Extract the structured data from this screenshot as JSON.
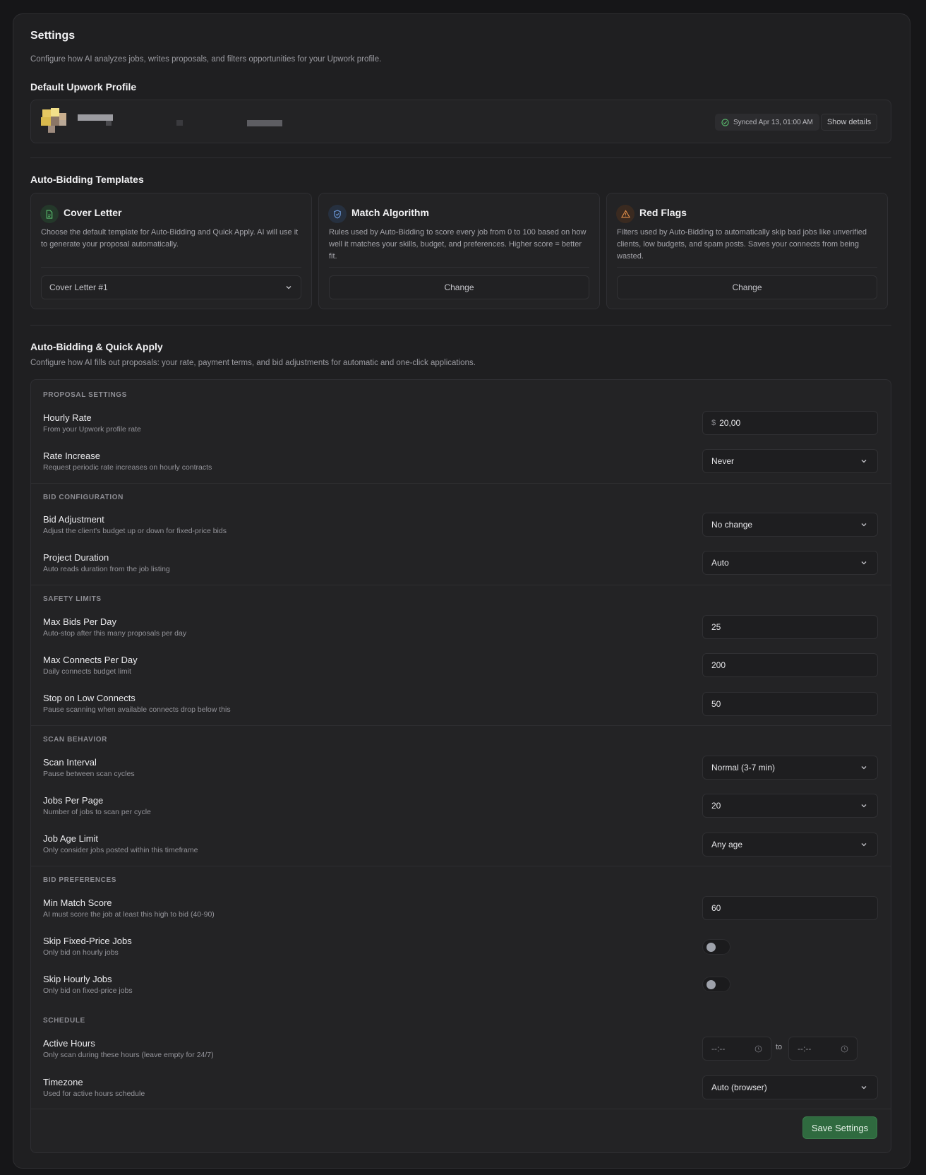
{
  "header": {
    "title": "Settings",
    "subtitle": "Configure how AI analyzes jobs, writes proposals, and filters opportunities for your Upwork profile."
  },
  "profile": {
    "section_title": "Default Upwork Profile",
    "sync_status": "Synced Apr 13, 01:00 AM",
    "show_details_label": "Show details"
  },
  "templates": {
    "section_title": "Auto-Bidding Templates",
    "cards": [
      {
        "title": "Cover Letter",
        "icon": "document-icon",
        "description": "Choose the default template for Auto-Bidding and Quick Apply. AI will use it to generate your proposal automatically.",
        "control_value": "Cover Letter #1"
      },
      {
        "title": "Match Algorithm",
        "icon": "shield-icon",
        "description": "Rules used by Auto-Bidding to score every job from 0 to 100 based on how well it matches your skills, budget, and preferences. Higher score = better fit.",
        "control_value": "Change"
      },
      {
        "title": "Red Flags",
        "icon": "warning-icon",
        "description": "Filters used by Auto-Bidding to automatically skip bad jobs like unverified clients, low budgets, and spam posts. Saves your connects from being wasted.",
        "control_value": "Change"
      }
    ]
  },
  "auto_bidding": {
    "section_title": "Auto-Bidding & Quick Apply",
    "subtitle": "Configure how AI fills out proposals: your rate, payment terms, and bid adjustments for automatic and one-click applications.",
    "proposal_settings": {
      "label": "PROPOSAL SETTINGS",
      "hourly_rate": {
        "title": "Hourly Rate",
        "sub": "From your Upwork profile rate",
        "prefix": "$",
        "value": "20,00"
      },
      "rate_increase": {
        "title": "Rate Increase",
        "sub": "Request periodic rate increases on hourly contracts",
        "value": "Never"
      }
    },
    "bid_configuration": {
      "label": "BID CONFIGURATION",
      "bid_adjustment": {
        "title": "Bid Adjustment",
        "sub": "Adjust the client's budget up or down for fixed-price bids",
        "value": "No change"
      },
      "project_duration": {
        "title": "Project Duration",
        "sub": "Auto reads duration from the job listing",
        "value": "Auto"
      }
    },
    "safety_limits": {
      "label": "SAFETY LIMITS",
      "max_bids": {
        "title": "Max Bids Per Day",
        "sub": "Auto-stop after this many proposals per day",
        "value": "25"
      },
      "max_connects": {
        "title": "Max Connects Per Day",
        "sub": "Daily connects budget limit",
        "value": "200"
      },
      "low_connects": {
        "title": "Stop on Low Connects",
        "sub": "Pause scanning when available connects drop below this",
        "value": "50"
      }
    },
    "scan_behavior": {
      "label": "SCAN BEHAVIOR",
      "scan_interval": {
        "title": "Scan Interval",
        "sub": "Pause between scan cycles",
        "value": "Normal (3-7 min)"
      },
      "jobs_per_page": {
        "title": "Jobs Per Page",
        "sub": "Number of jobs to scan per cycle",
        "value": "20"
      },
      "job_age": {
        "title": "Job Age Limit",
        "sub": "Only consider jobs posted within this timeframe",
        "value": "Any age"
      }
    },
    "bid_preferences": {
      "label": "BID PREFERENCES",
      "min_match": {
        "title": "Min Match Score",
        "sub": "AI must score the job at least this high to bid (40-90)",
        "value": "60"
      },
      "skip_fixed": {
        "title": "Skip Fixed-Price Jobs",
        "sub": "Only bid on hourly jobs",
        "enabled": false
      },
      "skip_hourly": {
        "title": "Skip Hourly Jobs",
        "sub": "Only bid on fixed-price jobs",
        "enabled": false
      }
    },
    "schedule": {
      "label": "SCHEDULE",
      "active_hours": {
        "title": "Active Hours",
        "sub": "Only scan during these hours (leave empty for 24/7)",
        "from": "--:--",
        "separator": "to",
        "to": "--:--"
      },
      "timezone": {
        "title": "Timezone",
        "sub": "Used for active hours schedule",
        "value": "Auto (browser)"
      }
    },
    "save_label": "Save Settings"
  },
  "colors": {
    "accent_green": "#2f6a3f",
    "cover_icon": "#5bbf6f",
    "match_icon": "#6f9de0",
    "flag_icon": "#e4904a"
  }
}
